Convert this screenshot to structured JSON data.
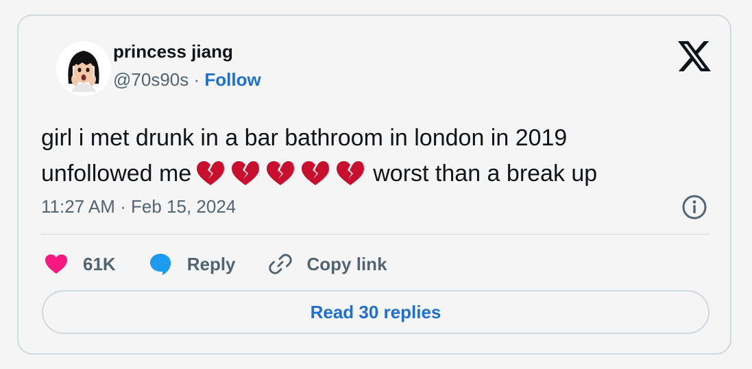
{
  "author": {
    "name": "princess jiang",
    "handle": "@70s90s",
    "separator": "·",
    "follow_label": "Follow"
  },
  "tweet": {
    "line1": "girl i met drunk in a bar bathroom in london in 2019",
    "line2_before": "unfollowed me",
    "line2_after": "worst than a break up",
    "emoji": [
      "broken-heart",
      "broken-heart",
      "broken-heart",
      "broken-heart",
      "broken-heart"
    ]
  },
  "timestamp": "11:27 AM · Feb 15, 2024",
  "actions": {
    "like_count": "61K",
    "reply_label": "Reply",
    "copy_label": "Copy link"
  },
  "read_replies_label": "Read 30 replies",
  "icons": {
    "logo": "x-logo-icon",
    "info": "info-icon",
    "like": "heart-icon",
    "reply": "speech-bubble-icon",
    "copy": "link-icon"
  },
  "colors": {
    "accent": "#1d6fd1",
    "heart": "#f91880",
    "reply": "#1d9bf0",
    "broken_heart": "#c8102e",
    "text": "#0f1419",
    "muted": "#536471",
    "border": "#cfd9de"
  }
}
